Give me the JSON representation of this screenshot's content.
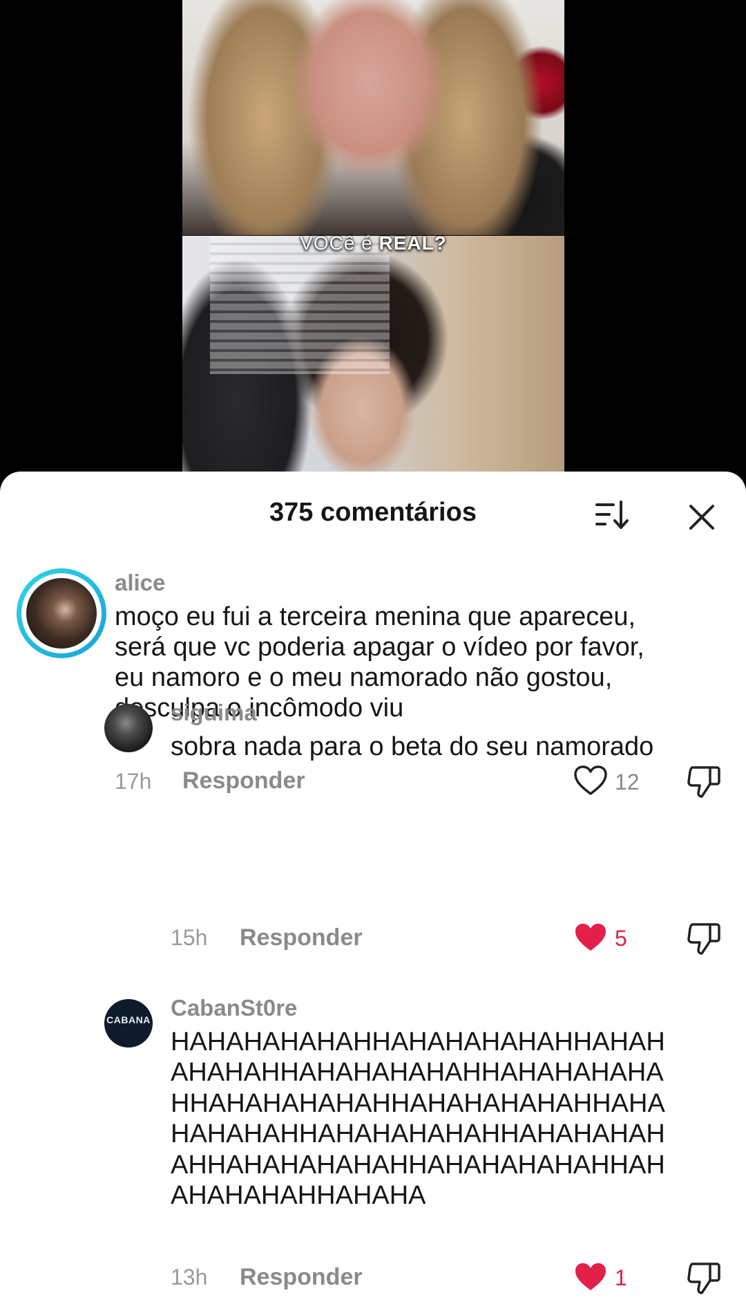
{
  "video": {
    "caption_part1": "VOCê é",
    "caption_part2": "REAL?"
  },
  "sheet": {
    "title": "375 comentários",
    "sort_icon": "sort-icon",
    "close_icon": "close-icon"
  },
  "comments": [
    {
      "username": "alice",
      "lines": [
        "moço eu fui a terceira menina que apareceu,",
        "será que vc poderia apagar o vídeo por favor,",
        "eu namoro e o meu namorado não gostou,",
        "desculpa o incômodo viu"
      ],
      "time": "17h",
      "reply_label": "Responder",
      "likes": "12",
      "liked": false
    },
    {
      "username": "siguima",
      "lines": [
        "sobra nada para o beta do seu namorado"
      ],
      "time": "15h",
      "reply_label": "Responder",
      "likes": "5",
      "liked": true
    },
    {
      "username": "CabanSt0re",
      "lines": [
        "HAHAHAHAHAHHAHAHAHAHAHHAHAH",
        "AHAHAHHAHAHAHAHAHHAHAHAHAHA",
        "HHAHAHAHAHAHHAHAHAHAHAHHAHA",
        "HAHAHAHHAHAHAHAHAHHAHAHAHAH",
        "AHHAHAHAHAHAHHAHAHAHAHAHHAH",
        "AHAHAHAHHAHAHA"
      ],
      "time": "13h",
      "reply_label": "Responder",
      "likes": "1",
      "liked": true,
      "avatar_text": "CABANA"
    }
  ],
  "colors": {
    "liked_red": "#e2204a",
    "story_ring_start": "#2fd5e8",
    "story_ring_end": "#1aa3d6"
  }
}
